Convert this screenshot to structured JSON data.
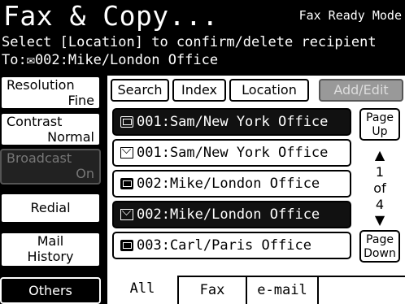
{
  "header": {
    "title": "Fax & Copy...",
    "mode": "Fax Ready Mode",
    "instruction": "Select [Location] to confirm/delete recipient",
    "to_line": "To:✉002:Mike/London Office"
  },
  "left_buttons": {
    "resolution_label": "Resolution",
    "resolution_value": "Fine",
    "contrast_label": "Contrast",
    "contrast_value": "Normal",
    "broadcast_label": "Broadcast",
    "broadcast_value": "On",
    "redial": "Redial",
    "mail_history_l1": "Mail",
    "mail_history_l2": "History",
    "others": "Others"
  },
  "top_tabs": {
    "search": "Search",
    "index": "Index",
    "location": "Location",
    "add_edit": "Add/Edit"
  },
  "entries": [
    {
      "text": "001:Sam/New York Office",
      "icon": "fax-icon",
      "selected": true
    },
    {
      "text": "001:Sam/New York Office",
      "icon": "mail-icon",
      "selected": false
    },
    {
      "text": "002:Mike/London Office",
      "icon": "fax-icon",
      "selected": false
    },
    {
      "text": "002:Mike/London Office",
      "icon": "mail-icon",
      "selected": true
    },
    {
      "text": "003:Carl/Paris Office",
      "icon": "fax-icon",
      "selected": false
    }
  ],
  "pager": {
    "page_up_l1": "Page",
    "page_up_l2": "Up",
    "current": "1",
    "of": "of",
    "total": "4",
    "page_down_l1": "Page",
    "page_down_l2": "Down"
  },
  "bottom_tabs": {
    "all": "All",
    "fax": "Fax",
    "email": "e-mail"
  },
  "colors": {
    "background": "#000000",
    "panel": "#ffffff",
    "disabled": "#999999"
  }
}
